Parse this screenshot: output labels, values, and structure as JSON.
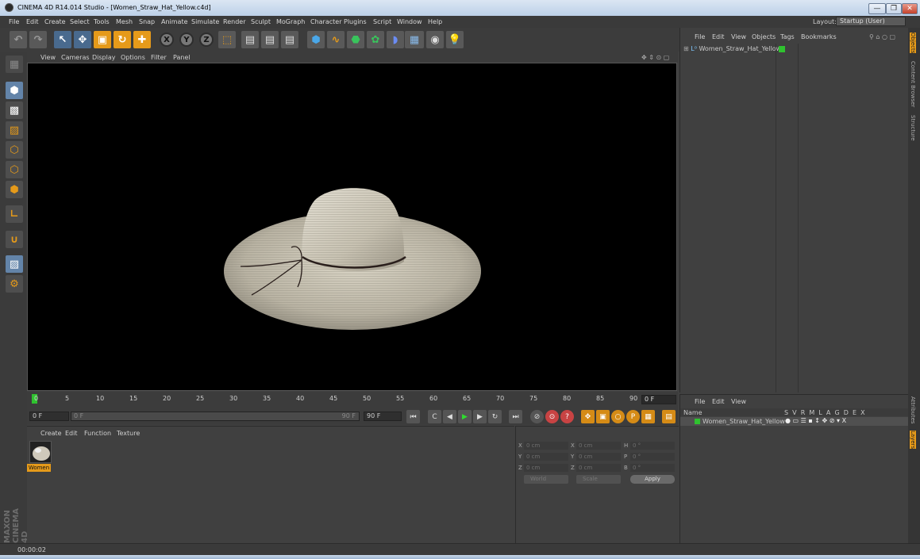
{
  "window": {
    "title": "CINEMA 4D R14.014 Studio - [Women_Straw_Hat_Yellow.c4d]",
    "min_label": "—",
    "max_label": "❐",
    "close_label": "✕"
  },
  "menubar": {
    "items": [
      "File",
      "Edit",
      "Create",
      "Select",
      "Tools",
      "Mesh",
      "Snap",
      "Animate",
      "Simulate",
      "Render",
      "Sculpt",
      "MoGraph",
      "Character",
      "Plugins",
      "Script",
      "Window",
      "Help"
    ],
    "layout_label": "Layout:",
    "layout_value": "Startup (User)"
  },
  "viewport": {
    "menu": [
      "View",
      "Cameras",
      "Display",
      "Options",
      "Filter",
      "Panel"
    ]
  },
  "timeline": {
    "ticks": [
      "0",
      "5",
      "10",
      "15",
      "20",
      "25",
      "30",
      "35",
      "40",
      "45",
      "50",
      "55",
      "60",
      "65",
      "70",
      "75",
      "80",
      "85",
      "90"
    ],
    "current_frame": "0 F",
    "start_field": "0 F",
    "slider_start": "0 F",
    "slider_end": "90 F",
    "end_field": "90 F"
  },
  "material_manager": {
    "menu": [
      "Create",
      "Edit",
      "Function",
      "Texture"
    ],
    "material_name": "Women"
  },
  "coord_manager": {
    "labels": {
      "x": "X",
      "y": "Y",
      "z": "Z",
      "h": "H",
      "p": "P",
      "b": "B"
    },
    "pos_x": "0 cm",
    "pos_y": "0 cm",
    "pos_z": "0 cm",
    "size_x": "0 cm",
    "size_y": "0 cm",
    "size_z": "0 cm",
    "rot_h": "0 °",
    "rot_p": "0 °",
    "rot_b": "0 °",
    "mode_world": "World",
    "mode_scale": "Scale",
    "apply": "Apply"
  },
  "object_manager": {
    "menu": [
      "File",
      "Edit",
      "View",
      "Objects",
      "Tags",
      "Bookmarks"
    ],
    "object_name": "Women_Straw_Hat_Yellow"
  },
  "layer_manager": {
    "menu": [
      "File",
      "Edit",
      "View"
    ],
    "header_name": "Name",
    "header_cols": "S  V  R  M  L  A  G  D  E  X",
    "layer_name": "Women_Straw_Hat_Yellow"
  },
  "right_tabs": [
    "Objects",
    "Content Browser",
    "Structure",
    "Attributes",
    "Layers"
  ],
  "status": {
    "time": "00:00:02"
  },
  "colors": {
    "accent": "#e59a1a",
    "green": "#2fc22f",
    "background": "#404040"
  }
}
